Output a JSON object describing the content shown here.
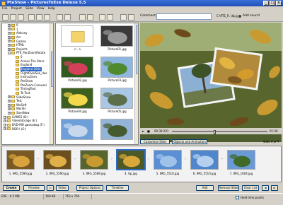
{
  "app": {
    "title": "PteShow - PicturesToExe Deluxe 5.5"
  },
  "menu": [
    "File",
    "Project",
    "Slide",
    "View",
    "Help"
  ],
  "toolbar": {
    "comment_label": "Comment",
    "comment_value": "",
    "file_field": "C:\\PTE_P...\\6p.jpg",
    "add_sound_label": "Add sound"
  },
  "tree": {
    "items": [
      {
        "label": "0",
        "depth": 1,
        "exp": "+"
      },
      {
        "label": "1",
        "depth": 1,
        "exp": "+"
      },
      {
        "label": "Aleksey",
        "depth": 1,
        "exp": "+"
      },
      {
        "label": "Arc",
        "depth": 1,
        "exp": "+"
      },
      {
        "label": "Games",
        "depth": 1,
        "exp": "+"
      },
      {
        "label": "HTML",
        "depth": 1,
        "exp": "+"
      },
      {
        "label": "Projects",
        "depth": 1,
        "exp": "+"
      },
      {
        "label": "PTE_PanZoomRotate",
        "depth": 1,
        "exp": "-"
      },
      {
        "label": "0",
        "depth": 2,
        "exp": ""
      },
      {
        "label": "Across The Stars",
        "depth": 2,
        "exp": ""
      },
      {
        "label": "England",
        "depth": 2,
        "exp": ""
      },
      {
        "label": "England 2004",
        "depth": 2,
        "exp": "",
        "selected": true
      },
      {
        "label": "FlightOverSea_dee",
        "depth": 2,
        "exp": ""
      },
      {
        "label": "Instructions",
        "depth": 2,
        "exp": ""
      },
      {
        "label": "PteShow",
        "depth": 2,
        "exp": ""
      },
      {
        "label": "PteZoom-Carousel",
        "depth": 2,
        "exp": ""
      },
      {
        "label": "TimingText",
        "depth": 2,
        "exp": ""
      },
      {
        "label": "To Test",
        "depth": 2,
        "exp": ""
      },
      {
        "label": "SlideShow",
        "depth": 1,
        "exp": "+"
      },
      {
        "label": "Test",
        "depth": 1,
        "exp": "+"
      },
      {
        "label": "WnSoft",
        "depth": 1,
        "exp": "+"
      },
      {
        "label": "Worlds",
        "depth": 1,
        "exp": "+"
      },
      {
        "label": "SaveNow",
        "depth": 1,
        "exp": "+"
      },
      {
        "label": "GAMES (D:)",
        "depth": 0,
        "exp": "+"
      },
      {
        "label": "VideoStorage (E:)",
        "depth": 0,
        "exp": "+"
      },
      {
        "label": "DVD-RW дисковод (F:)",
        "depth": 0,
        "exp": "+"
      },
      {
        "label": "DDR-I (G:)",
        "depth": 0,
        "exp": "+"
      },
      {
        "label": "",
        "depth": 0,
        "exp": ""
      },
      {
        "label": "",
        "depth": 0,
        "exp": ""
      },
      {
        "label": "",
        "depth": 0,
        "exp": ""
      }
    ]
  },
  "thumbnails": [
    {
      "caption": "<...>",
      "kind": "folder"
    },
    {
      "caption": "Picture01.jpg",
      "kind": "bw"
    },
    {
      "caption": "Picture02.jpg",
      "kind": "rose"
    },
    {
      "caption": "Picture03.jpg",
      "kind": "field"
    },
    {
      "caption": "Picture04.jpg",
      "kind": "yellow"
    },
    {
      "caption": "Picture05.jpg",
      "kind": "tower"
    },
    {
      "caption": "",
      "kind": "sky"
    },
    {
      "caption": "",
      "kind": "tower2"
    }
  ],
  "preview": {
    "time_current": "00:39.201",
    "time_total": "01:28",
    "progress": 0.45,
    "customize_label": "Customize Slide",
    "objects_label": "Objects and Animation",
    "slide_of": "Slide 4 of 7"
  },
  "slides": [
    {
      "caption": "1. IMG_5590.jpg",
      "kind": "autumn1"
    },
    {
      "caption": "2. IMG_5590.jpg",
      "kind": "autumn2"
    },
    {
      "caption": "3. IMG_5589.jpg",
      "kind": "autumn3"
    },
    {
      "caption": "4. 6p.jpg",
      "kind": "autumn4",
      "selected": true
    },
    {
      "caption": "5. IMG_5510.jpg",
      "kind": "sky1"
    },
    {
      "caption": "6. IMG_5510.jpg",
      "kind": "sky2"
    },
    {
      "caption": "7. IMG_1004.jpg",
      "kind": "sky3"
    }
  ],
  "bottom": {
    "create_label": "Create",
    "preview_label": "Preview",
    "video_label": "Video",
    "project_options_label": "Project Options",
    "timeline_label": "Timeline",
    "add_label": "Add",
    "remove_label": "Remove Slide",
    "clear_label": "Clear List"
  },
  "status": {
    "exe": "EXE - 6.5 MB",
    "size": "169 KB",
    "dims": "763 x 760",
    "hold_label": "Hold time points"
  },
  "colors": {
    "accent": "#316ac5",
    "titlebar": "#2250b8",
    "face": "#d4d0c8"
  }
}
